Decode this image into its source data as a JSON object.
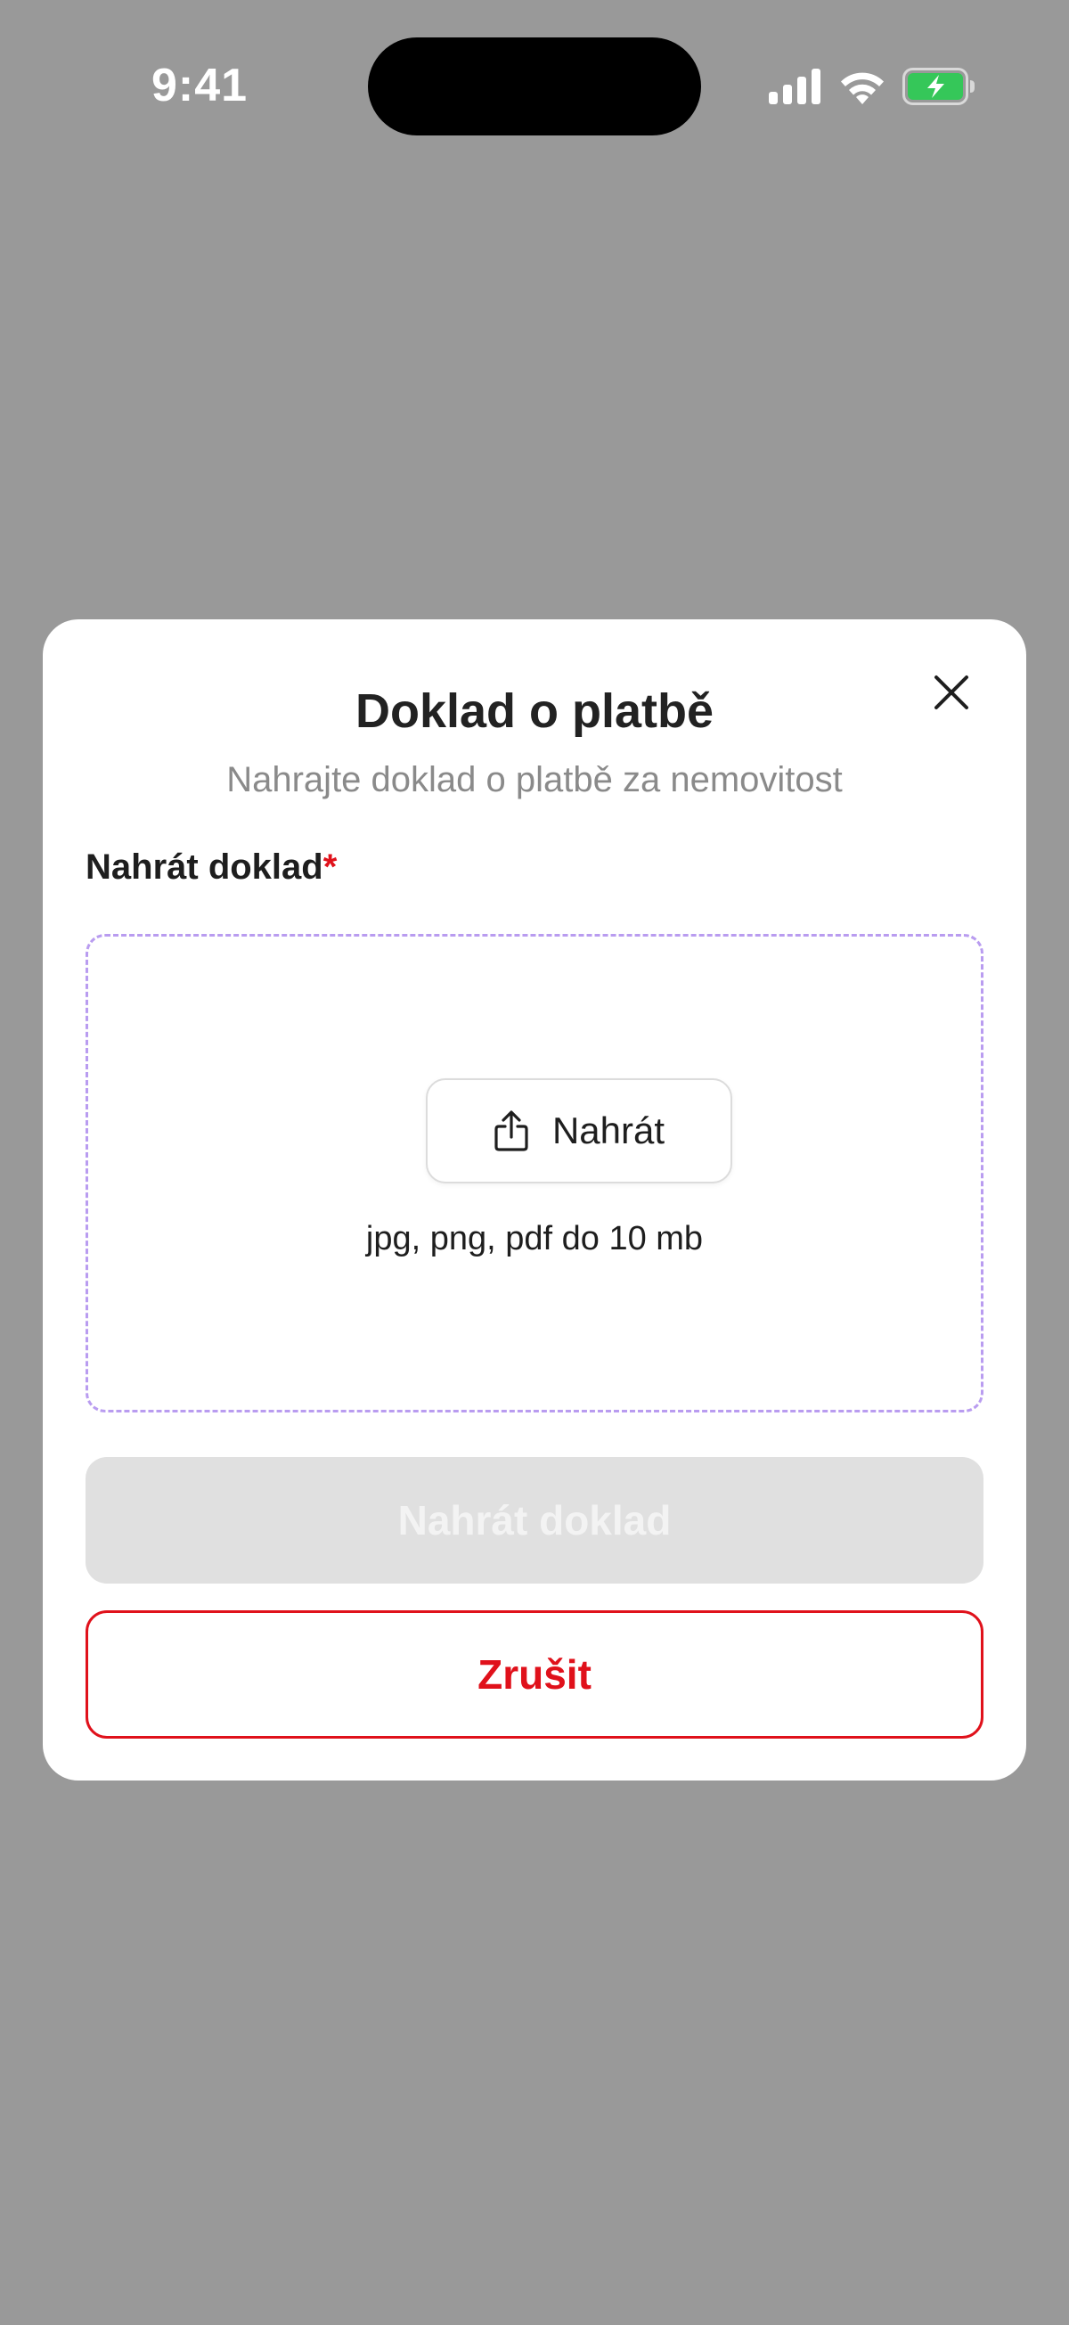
{
  "status_bar": {
    "time": "9:41"
  },
  "modal": {
    "title": "Doklad o platbě",
    "subtitle": "Nahrajte doklad o platbě za nemovitost",
    "field_label": "Nahrát doklad",
    "required_marker": "*",
    "upload_button_label": "Nahrát",
    "upload_hint": "jpg, png, pdf do 10 mb",
    "submit_label": "Nahrát doklad",
    "cancel_label": "Zrušit"
  },
  "colors": {
    "backdrop": "#999999",
    "accent_red": "#e0111b",
    "dropzone_border": "#b99cf0",
    "disabled_button": "#e0e0e0",
    "battery_green": "#35c759"
  },
  "icons": {
    "close": "close-icon",
    "upload": "share-upload-icon",
    "signal": "cellular-signal-icon",
    "wifi": "wifi-icon",
    "battery": "battery-charging-icon"
  }
}
